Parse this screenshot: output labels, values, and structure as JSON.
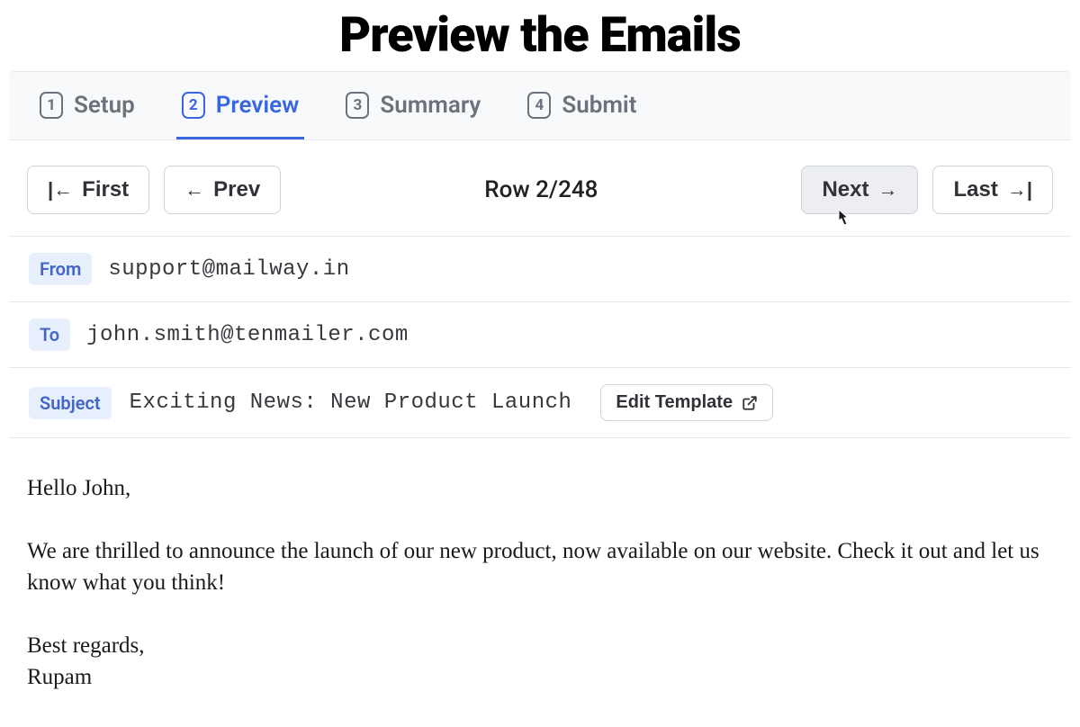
{
  "title": "Preview the Emails",
  "wizard": {
    "tabs": [
      {
        "num": "1",
        "label": "Setup",
        "active": false
      },
      {
        "num": "2",
        "label": "Preview",
        "active": true
      },
      {
        "num": "3",
        "label": "Summary",
        "active": false
      },
      {
        "num": "4",
        "label": "Submit",
        "active": false
      }
    ]
  },
  "nav": {
    "first": "First",
    "prev": "Prev",
    "next": "Next",
    "last": "Last",
    "row_prefix": "Row ",
    "current": 2,
    "total": 248
  },
  "email": {
    "from_label": "From",
    "from": "support@mailway.in",
    "to_label": "To",
    "to": "john.smith@tenmailer.com",
    "subject_label": "Subject",
    "subject": "Exciting News: New Product Launch",
    "edit_template": "Edit Template",
    "body": "Hello John,\n\nWe are thrilled to announce the launch of our new product, now available on our website. Check it out and let us know what you think!\n\nBest regards,\nRupam"
  }
}
